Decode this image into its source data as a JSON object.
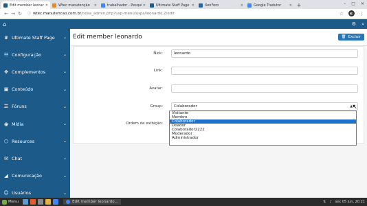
{
  "browser": {
    "tabs": [
      {
        "title": "Edit member leonardo",
        "color": "#1c5a89",
        "active": true
      },
      {
        "title": "Wtec manutenção",
        "color": "#e08a2b",
        "active": false
      },
      {
        "title": "trabalhador - Pesquisa",
        "color": "#4285f4",
        "active": false
      },
      {
        "title": "Ultimate Staff Page",
        "color": "#1c5a89",
        "active": false
      },
      {
        "title": "XenForo",
        "color": "#2a67a8",
        "active": false
      },
      {
        "title": "Google Tradutor",
        "color": "#4285f4",
        "active": false
      }
    ],
    "new_tab": "+",
    "url_host": "wtec.manutencao.com.br",
    "url_path": "/nosa_admin.php?usp-menu/usps/leonardo.2/edit"
  },
  "topbar": {},
  "sidebar": {
    "items": [
      {
        "label": "Ultimate Staff Page",
        "icon": "crown-icon",
        "glyph": "♛",
        "name": "ultimate-staff-page"
      },
      {
        "label": "Configuração",
        "icon": "sliders-icon",
        "glyph": "☷",
        "name": "configuracao"
      },
      {
        "label": "Complementos",
        "icon": "puzzle-icon",
        "glyph": "✥",
        "name": "complementos"
      },
      {
        "label": "Conteúdo",
        "icon": "content-icon",
        "glyph": "▣",
        "name": "conteudo"
      },
      {
        "label": "Fóruns",
        "icon": "forum-icon",
        "glyph": "☰",
        "name": "foruns"
      },
      {
        "label": "Mídia",
        "icon": "camera-icon",
        "glyph": "◉",
        "name": "midia"
      },
      {
        "label": "Resources",
        "icon": "resources-icon",
        "glyph": "⬡",
        "name": "resources"
      },
      {
        "label": "Chat",
        "icon": "chat-icon",
        "glyph": "✉",
        "name": "chat"
      },
      {
        "label": "Comunicação",
        "icon": "megaphone-icon",
        "glyph": "◢",
        "name": "comunicacao"
      },
      {
        "label": "Usuários",
        "icon": "user-icon",
        "glyph": "☺",
        "name": "usuarios"
      }
    ]
  },
  "main": {
    "title": "Edit member leonardo",
    "delete_label": "Excluir",
    "form": {
      "nick_label": "Nick:",
      "nick_value": "leonardo",
      "link_label": "Link:",
      "link_value": "",
      "avatar_label": "Avatar:",
      "avatar_value": "",
      "group_label": "Group:",
      "group_value": "Colaborador",
      "order_label": "Ordem de exibição:"
    },
    "group_options": [
      "Visitante",
      "Membro",
      "Colaborador",
      "Doador",
      "Colaborador2222",
      "Moderador",
      "Administrador"
    ],
    "group_selected_index": 2
  },
  "taskbar": {
    "menu_label": "Menu",
    "window_title": "Edit member leonardo...",
    "clock": "sex 05 jun, 20:21"
  },
  "colors": {
    "accent": "#1c5a89",
    "button": "#2577b8",
    "selection": "#1e70c8"
  }
}
